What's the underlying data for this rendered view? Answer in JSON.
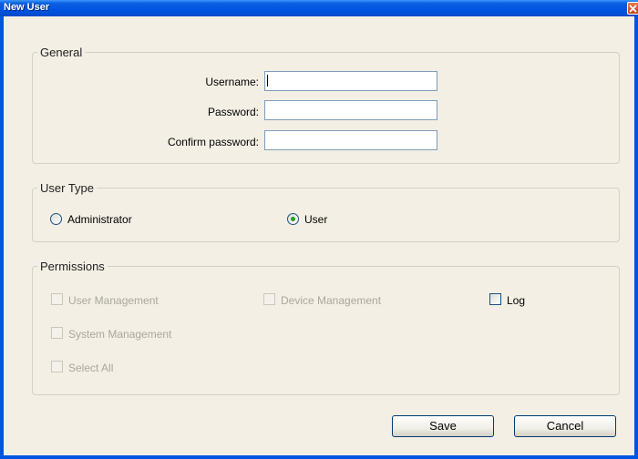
{
  "window": {
    "title": "New User"
  },
  "general": {
    "legend": "General",
    "username": {
      "label": "Username:",
      "value": ""
    },
    "password": {
      "label": "Password:",
      "value": ""
    },
    "confirm_password": {
      "label": "Confirm password:",
      "value": ""
    }
  },
  "user_type": {
    "legend": "User Type",
    "options": [
      {
        "label": "Administrator",
        "selected": false
      },
      {
        "label": "User",
        "selected": true
      }
    ]
  },
  "permissions": {
    "legend": "Permissions",
    "items": [
      {
        "label": "User Management",
        "checked": false,
        "enabled": false
      },
      {
        "label": "Device Management",
        "checked": false,
        "enabled": false
      },
      {
        "label": "Log",
        "checked": false,
        "enabled": true
      },
      {
        "label": "System Management",
        "checked": false,
        "enabled": false
      },
      {
        "label": "Select All",
        "checked": false,
        "enabled": false
      }
    ]
  },
  "buttons": {
    "save": "Save",
    "cancel": "Cancel"
  },
  "icons": {
    "close": "close-icon"
  },
  "colors": {
    "title_bar": "#0054e3",
    "radio_selected_dot": "#21a121",
    "dialog_bg": "#f3efe4"
  }
}
